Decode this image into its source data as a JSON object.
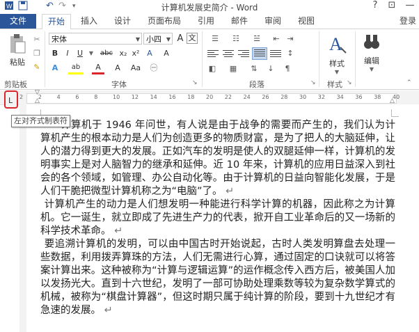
{
  "window": {
    "title": "计算机发展史简介 - Word",
    "login": "登录"
  },
  "tabs": {
    "file": "文件",
    "items": [
      "开始",
      "插入",
      "设计",
      "页面布局",
      "引用",
      "邮件",
      "审阅",
      "视图"
    ]
  },
  "ribbon": {
    "clipboard": {
      "paste": "粘贴",
      "label": "剪贴板"
    },
    "font": {
      "name": "宋体",
      "size": "小四",
      "label": "字体",
      "grow": "A",
      "bold": "B",
      "italic": "I",
      "underline": "U",
      "strike": "abc",
      "sub": "x₂",
      "sup": "x²",
      "clear": "A",
      "highlight": "ab",
      "color": "A",
      "shade": "A",
      "case": "Aa",
      "wen": "文",
      "border": "A"
    },
    "paragraph": {
      "label": "段落"
    },
    "styles": {
      "label": "样式"
    },
    "editing": {
      "label": "编辑"
    }
  },
  "ruler": {
    "ticks": [
      "2",
      "2",
      "4",
      "6",
      "8",
      "10",
      "12",
      "14",
      "16",
      "18",
      "20",
      "22",
      "24",
      "26",
      "28",
      "30",
      "32",
      "34",
      "36",
      "38",
      "40"
    ],
    "selector_glyph": "L"
  },
  "tooltip": "左对齐式制表符",
  "document": {
    "paragraphs": [
      "计算机于 1946 年问世，有人说是由于战争的需要而产生的，我们认为计算机产生的根本动力是人们为创造更多的物质财富，是为了把人的大脑延伸，让人的潜力得到更大的发展。正如汽车的发明是使人的双腿延伸一样，计算机的发明事实上是对人脑智力的继承和延伸。近 10 年来，计算机的应用日益深入到社会的各个领域，如管理、办公自动化等。由于计算机的日益向智能化发展，于是人们干脆把微型计算机称之为“电脑”了。",
      "计算机产生的动力是人们想发明一种能进行科学计算的机器，因此称之为计算机。它一诞生，就立即成了先进生产力的代表，掀开自工业革命后的又一场新的科学技术革命。",
      "要追溯计算机的发明，可以由中国古时开始说起，古时人类发明算盘去处理一些数据，利用拨弄算珠的方法，人们无需进行心算，通过固定的口诀就可以将答案计算出来。这种被称为“计算与逻辑运算”的运作概念传入西方后，被美国人加以发扬光大。直到十六世纪，发明了一部可协助处理乘数等较为复杂数学算式的机械，被称为“棋盘计算器”，但这时期只属于纯计算的阶段，要到十九世纪才有急速的发展。"
    ],
    "return_mark": "↵"
  },
  "colors": {
    "accent": "#2b579a",
    "highlight_marker": "#d9262b"
  }
}
